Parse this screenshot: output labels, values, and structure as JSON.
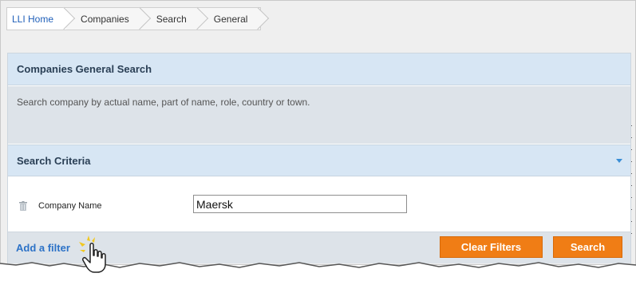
{
  "breadcrumb": {
    "items": [
      {
        "label": "LLI Home"
      },
      {
        "label": "Companies"
      },
      {
        "label": "Search"
      },
      {
        "label": "General"
      }
    ]
  },
  "panel": {
    "title": "Companies General Search",
    "description": "Search company by actual name, part of name, role, country or town."
  },
  "criteria": {
    "title": "Search Criteria",
    "collapse_icon": "chevron-down-icon"
  },
  "filters": [
    {
      "label": "Company Name",
      "value": "Maersk",
      "remove_icon": "trash-icon"
    }
  ],
  "footer": {
    "add_filter_label": "Add a filter",
    "clear_button_label": "Clear Filters",
    "search_button_label": "Search"
  },
  "colors": {
    "accent_button": "#f07d15",
    "link": "#2c72c7",
    "header_bg": "#d7e6f4"
  }
}
